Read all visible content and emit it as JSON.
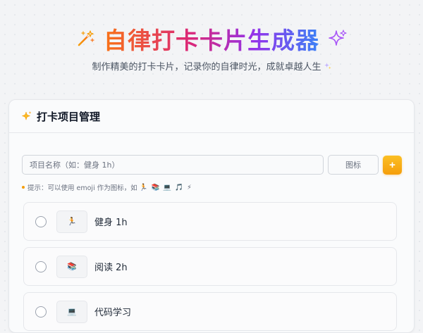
{
  "header": {
    "title": "自律打卡卡片生成器",
    "subtitle": "制作精美的打卡卡片，记录你的自律时光，成就卓越人生",
    "left_icon": "magic-wand-icon",
    "right_icon": "sparkles-icon",
    "gradient_colors": [
      "#f97316",
      "#db2777",
      "#9333ea",
      "#3b82f6"
    ]
  },
  "manage": {
    "title": "打卡项目管理",
    "title_icon": "sparkles-icon",
    "name_placeholder": "项目名称（如：健身 1h）",
    "icon_placeholder": "图标",
    "add_label": "+",
    "hint_text": "提示：可以使用 emoji 作为图标，如",
    "hint_icons": "🏃 📚 💻 🎵 ⚡",
    "accent_color": "#f59e0b"
  },
  "items": [
    {
      "icon": "🏃",
      "label": "健身 1h",
      "checked": false
    },
    {
      "icon": "📚",
      "label": "阅读 2h",
      "checked": false
    },
    {
      "icon": "💻",
      "label": "代码学习",
      "checked": false
    }
  ]
}
